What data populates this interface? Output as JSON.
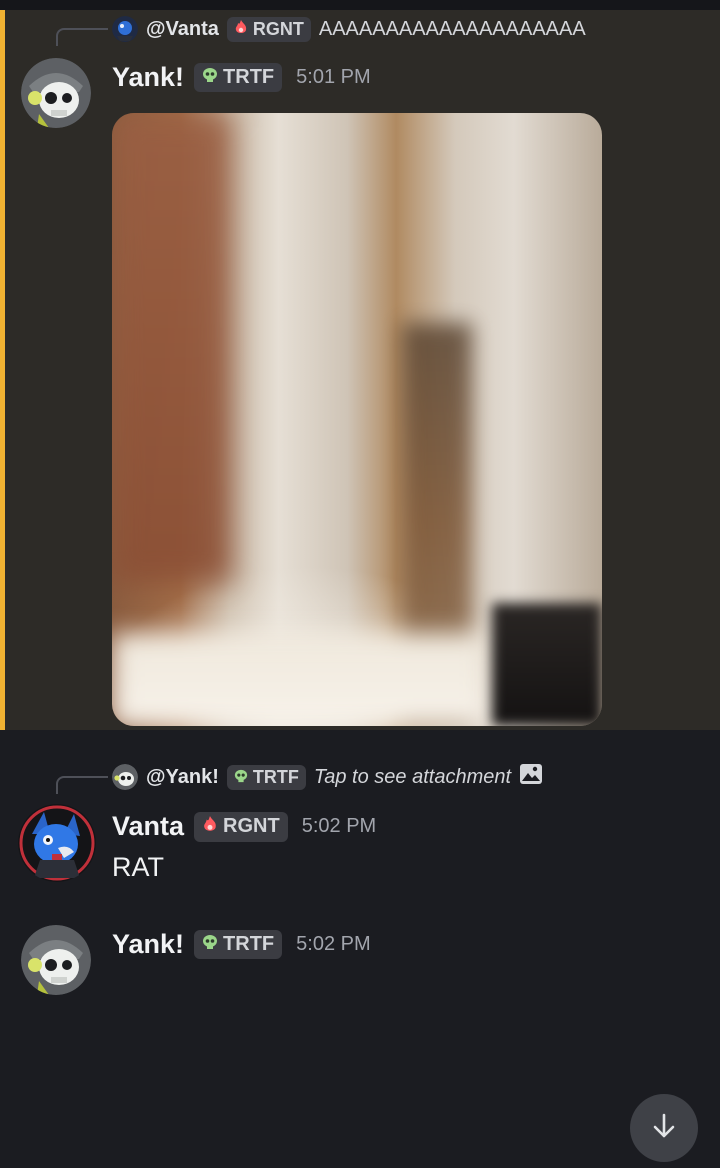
{
  "messages": [
    {
      "reply_to": {
        "name": "@Vanta",
        "tag": "RGNT",
        "text": "AAAAAAAAAAAAAAAAAAAA"
      },
      "author": "Yank!",
      "tag": "TRTF",
      "time": "5:01 PM",
      "highlighted": true
    },
    {
      "reply_to": {
        "name": "@Yank!",
        "tag": "TRTF",
        "text": "Tap to see attachment"
      },
      "author": "Vanta",
      "tag": "RGNT",
      "time": "5:02 PM",
      "content": "RAT"
    },
    {
      "author": "Yank!",
      "tag": "TRTF",
      "time": "5:02 PM"
    }
  ],
  "icons": {
    "trtf_tag_icon": "skull-icon",
    "rgnt_tag_icon": "flame-icon",
    "attachment_icon": "image-icon",
    "scroll_button_icon": "arrow-down-icon"
  },
  "colors": {
    "highlight_bar": "#f0b232",
    "highlight_bg": "#2d2b27",
    "background": "#1b1c21"
  }
}
